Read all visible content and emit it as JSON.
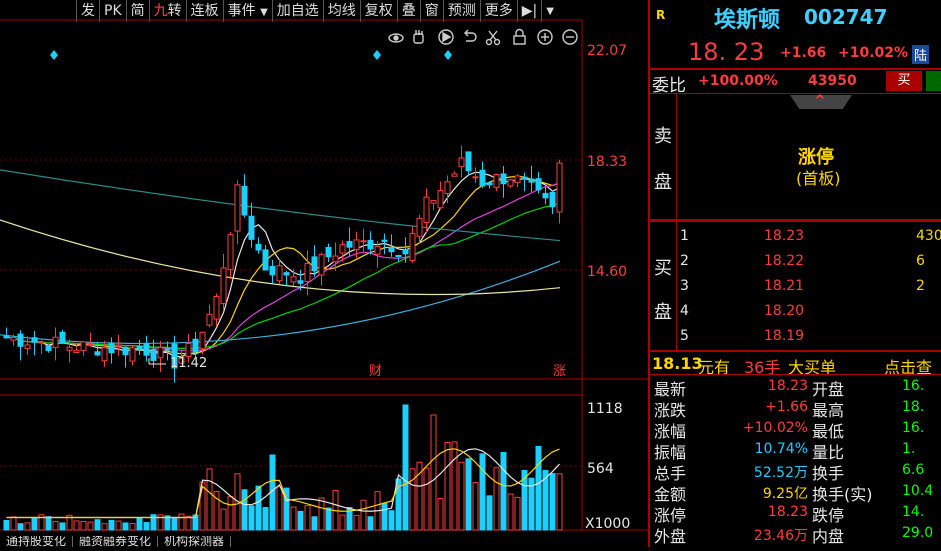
{
  "toolbar": {
    "buttons": [
      "发",
      "PK",
      "简",
      "九转",
      "连板",
      "事件",
      "加自选",
      "均线",
      "复权",
      "叠",
      "窗",
      "预测",
      "更多"
    ],
    "chart_tools": [
      "eye-icon",
      "hand-icon",
      "play-icon",
      "undo-icon",
      "scissors-icon",
      "lock-icon",
      "zoom-in-icon",
      "zoom-out-icon"
    ]
  },
  "price_axis": {
    "top": "22.07",
    "mid": "18.33",
    "low": "14.60"
  },
  "volume_axis": {
    "top": "1118",
    "mid": "564",
    "unit": "X1000"
  },
  "chart_labels": {
    "low_marker": "11.42",
    "cai": "财",
    "zhang": "涨"
  },
  "chart_data": {
    "type": "candlestick",
    "price_range": [
      11.0,
      22.07
    ],
    "low_label": 11.42,
    "last_close": 18.23,
    "colors": {
      "up": "#ff3b3b",
      "down": "#19d0ff",
      "ma5": "#e6e6e6",
      "ma10": "#ffd400",
      "ma20": "#e040e0",
      "ma30": "#00d000",
      "ma60": "#3ab0e0",
      "ma120": "#e6e6a0",
      "ma250": "#2a8a8a"
    }
  },
  "quote": {
    "r_badge": "R",
    "name": "埃斯顿",
    "code": "002747",
    "price": "18. 23",
    "change": "+1.66",
    "change_pct": "+10.02%",
    "lu_badge": "陆",
    "webi_label": "委比",
    "webi_value": "+100.00%",
    "webi_vol": "43950",
    "buy_btn": "买",
    "limit_title": "涨停",
    "limit_sub": "(首板)",
    "sell_label": [
      "卖",
      "盘"
    ],
    "buy_label": [
      "买",
      "盘"
    ],
    "bids": [
      {
        "level": "1",
        "price": "18.23",
        "vol": "430"
      },
      {
        "level": "2",
        "price": "18.22",
        "vol": "6"
      },
      {
        "level": "3",
        "price": "18.21",
        "vol": "2"
      },
      {
        "level": "4",
        "price": "18.20",
        "vol": ""
      },
      {
        "level": "5",
        "price": "18.19",
        "vol": ""
      }
    ],
    "big_order": {
      "price": "18.13",
      "text1": "元有",
      "qty": "36手",
      "text2": "大买单",
      "link": "点击查"
    }
  },
  "stats": {
    "left": [
      {
        "label": "最新",
        "value": "18.23"
      },
      {
        "label": "涨跌",
        "value": "+1.66"
      },
      {
        "label": "涨幅",
        "value": "+10.02%"
      },
      {
        "label": "振幅",
        "value": "10.74%"
      },
      {
        "label": "总手",
        "value": "52.52万"
      },
      {
        "label": "金额",
        "value": "9.25亿"
      },
      {
        "label": "涨停",
        "value": "18.23"
      },
      {
        "label": "外盘",
        "value": "23.46万"
      }
    ],
    "right": [
      {
        "label": "开盘",
        "value": "16."
      },
      {
        "label": "最高",
        "value": "18."
      },
      {
        "label": "最低",
        "value": "16."
      },
      {
        "label": "量比",
        "value": "1."
      },
      {
        "label": "换手",
        "value": "6.6"
      },
      {
        "label": "换手(实)",
        "value": "10.4"
      },
      {
        "label": "跌停",
        "value": "14."
      },
      {
        "label": "内盘",
        "value": "29.0"
      }
    ]
  },
  "bottom_tabs": [
    "通持股变化",
    "融资融券变化",
    "机构探测器"
  ]
}
